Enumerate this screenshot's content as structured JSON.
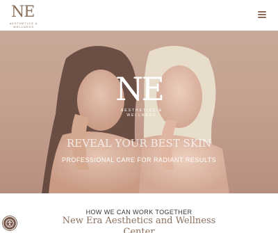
{
  "header": {
    "logo_letters": "NE",
    "logo_sub": "AESTHETICS & WELLNESS",
    "menu_icon": "hamburger-menu-icon"
  },
  "hero": {
    "logo_letters": "NE",
    "logo_sub": "AESTHETICS & WELLNESS",
    "tagline": "PROFESSIONAL CARE FOR RADIANT RESULTS",
    "headline": "REVEAL YOUR BEST SKIN"
  },
  "section": {
    "kicker": "HOW WE CAN WORK TOGETHER",
    "title_line1": "New Era Aesthetics and Wellness",
    "title_line2": "Center"
  },
  "accessibility": {
    "icon": "accessibility-icon"
  },
  "colors": {
    "brand": "#8a6f5c",
    "hero_bg": "#c4a090",
    "accent_dark": "#7a5a4c"
  }
}
